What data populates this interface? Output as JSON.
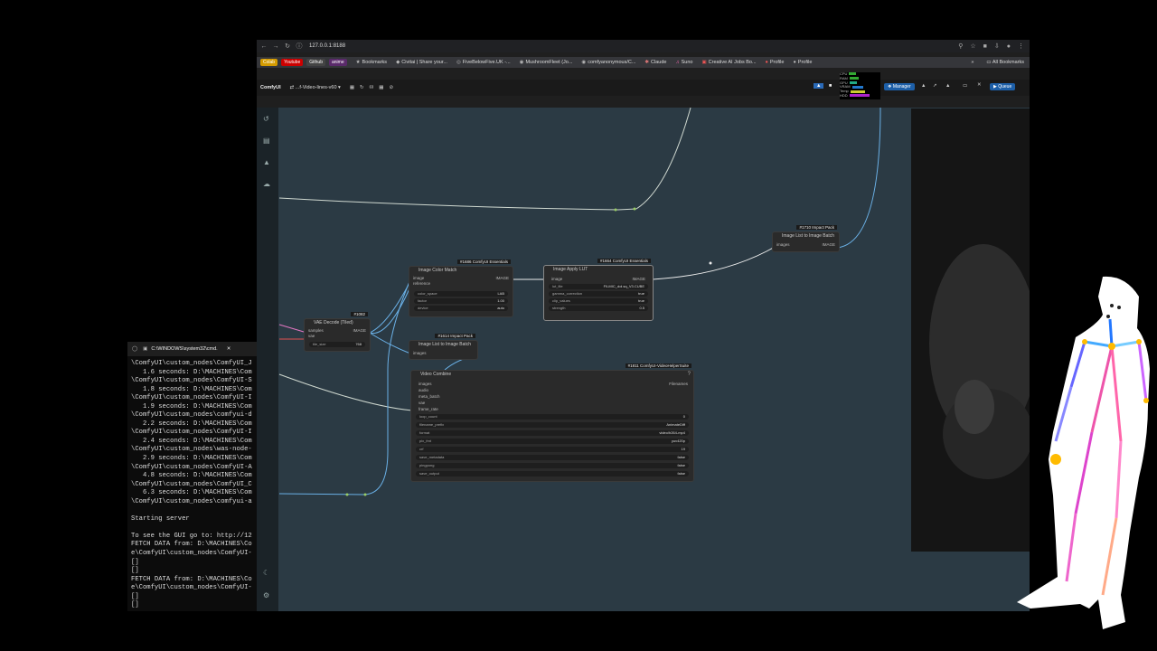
{
  "browser": {
    "address": "127.0.0.1:8188",
    "bookmarks": [
      {
        "label": "Colab",
        "icon": "colab-icon"
      },
      {
        "label": "Youtube",
        "icon": "youtube-icon"
      },
      {
        "label": "Github",
        "icon": "github-icon"
      },
      {
        "label": "anime",
        "icon": "folder-icon"
      },
      {
        "label": "Bookmarks",
        "icon": "star-icon"
      },
      {
        "label": "Civitai | Share your...",
        "icon": "civitai-icon"
      },
      {
        "label": "FiveBelowFive.UK -...",
        "icon": "globe-icon"
      },
      {
        "label": "MushroomFleet (Jo...",
        "icon": "github-icon"
      },
      {
        "label": "comfyanonymous/C...",
        "icon": "github-icon"
      },
      {
        "label": "Claude",
        "icon": "claude-icon"
      },
      {
        "label": "Suno",
        "icon": "suno-icon"
      },
      {
        "label": "Creative AI Jobs Bo...",
        "icon": "page-icon"
      },
      {
        "label": "Profile",
        "icon": "profile-icon"
      },
      {
        "label": "Profile",
        "icon": "profile-icon"
      }
    ],
    "all_bookmarks": "All Bookmarks"
  },
  "comfy": {
    "logo": "ComfyUI",
    "workflow": "...f-Video-lines-v60",
    "manager": "Manager",
    "queue": "Queue",
    "stats": [
      "CPU",
      "RAM",
      "GPU",
      "VRAM",
      "Temp",
      "HDD"
    ]
  },
  "nodes": {
    "vae_decode": {
      "tag": "#1082",
      "title": "VAE Decode (Tiled)",
      "in1": "samples",
      "in2": "vae",
      "out": "IMAGE",
      "w_label": "tile_size",
      "w_value": "768"
    },
    "color_match": {
      "tag": "#1686 ComfyUI Essentials",
      "title": "Image Color Match",
      "in1": "image",
      "in2": "reference",
      "out": "IMAGE",
      "w1": "color_space",
      "w1v": "LAB",
      "w2": "factor",
      "w2v": "1.00",
      "w3": "device",
      "w3v": "auto"
    },
    "apply_lut": {
      "tag": "#1664 ComfyUI Essentials",
      "title": "Image Apply LUT",
      "in1": "image",
      "out": "IMAGE",
      "w1": "lut_file",
      "w1v": "FILMIC_dol.sq_V3.CUBE",
      "w2": "gamma_correction",
      "w2v": "true",
      "w3": "clip_values",
      "w3v": "true",
      "w4": "strength",
      "w4v": "0.5"
    },
    "list_to_batch_top": {
      "tag": "#1710 Impact Pack",
      "title": "Image List to Image Batch",
      "in1": "images",
      "out": "IMAGE"
    },
    "list_to_batch_mid": {
      "tag": "#1614 Impact Pack",
      "title": "Image List to Image Batch",
      "in1": "images"
    },
    "video_combine": {
      "tag": "#1811 ComfyUI-VideoHelperSuite",
      "title": "Video Combine",
      "out": "Filenames",
      "inputs": [
        "images",
        "audio",
        "meta_batch",
        "vae",
        "frame_rate"
      ],
      "widgets": [
        {
          "label": "loop_count",
          "value": "0"
        },
        {
          "label": "filename_prefix",
          "value": "AnimateDiff"
        },
        {
          "label": "format",
          "value": "video/h264-mp4"
        },
        {
          "label": "pix_fmt",
          "value": "yuv420p"
        },
        {
          "label": "crf",
          "value": "19"
        },
        {
          "label": "save_metadata",
          "value": "false"
        },
        {
          "label": "pingpong",
          "value": "false"
        },
        {
          "label": "save_output",
          "value": "false"
        }
      ]
    }
  },
  "cmd": {
    "title": "C:\\WINDOWS\\system32\\cmd.",
    "lines": [
      "\\ComfyUI\\custom_nodes\\ComfyUI_J",
      "   1.6 seconds: D:\\MACHINES\\Com",
      "\\ComfyUI\\custom_nodes\\ComfyUI-S",
      "   1.8 seconds: D:\\MACHINES\\Com",
      "\\ComfyUI\\custom_nodes\\ComfyUI-I",
      "   1.9 seconds: D:\\MACHINES\\Com",
      "\\ComfyUI\\custom_nodes\\comfyui-d",
      "   2.2 seconds: D:\\MACHINES\\Com",
      "\\ComfyUI\\custom_nodes\\ComfyUI-I",
      "   2.4 seconds: D:\\MACHINES\\Com",
      "\\ComfyUI\\custom_nodes\\was-node-",
      "   2.9 seconds: D:\\MACHINES\\Com",
      "\\ComfyUI\\custom_nodes\\ComfyUI-A",
      "   4.8 seconds: D:\\MACHINES\\Com",
      "\\ComfyUI\\custom_nodes\\ComfyUI_C",
      "   6.3 seconds: D:\\MACHINES\\Com",
      "\\ComfyUI\\custom_nodes\\comfyui-a",
      "",
      "Starting server",
      "",
      "To see the GUI go to: http://12",
      "FETCH DATA from: D:\\MACHINES\\Co",
      "e\\ComfyUI\\custom_nodes\\ComfyUI-",
      "[]",
      "[]",
      "FETCH DATA from: D:\\MACHINES\\Co",
      "e\\ComfyUI\\custom_nodes\\ComfyUI-",
      "[]",
      "[]"
    ]
  }
}
